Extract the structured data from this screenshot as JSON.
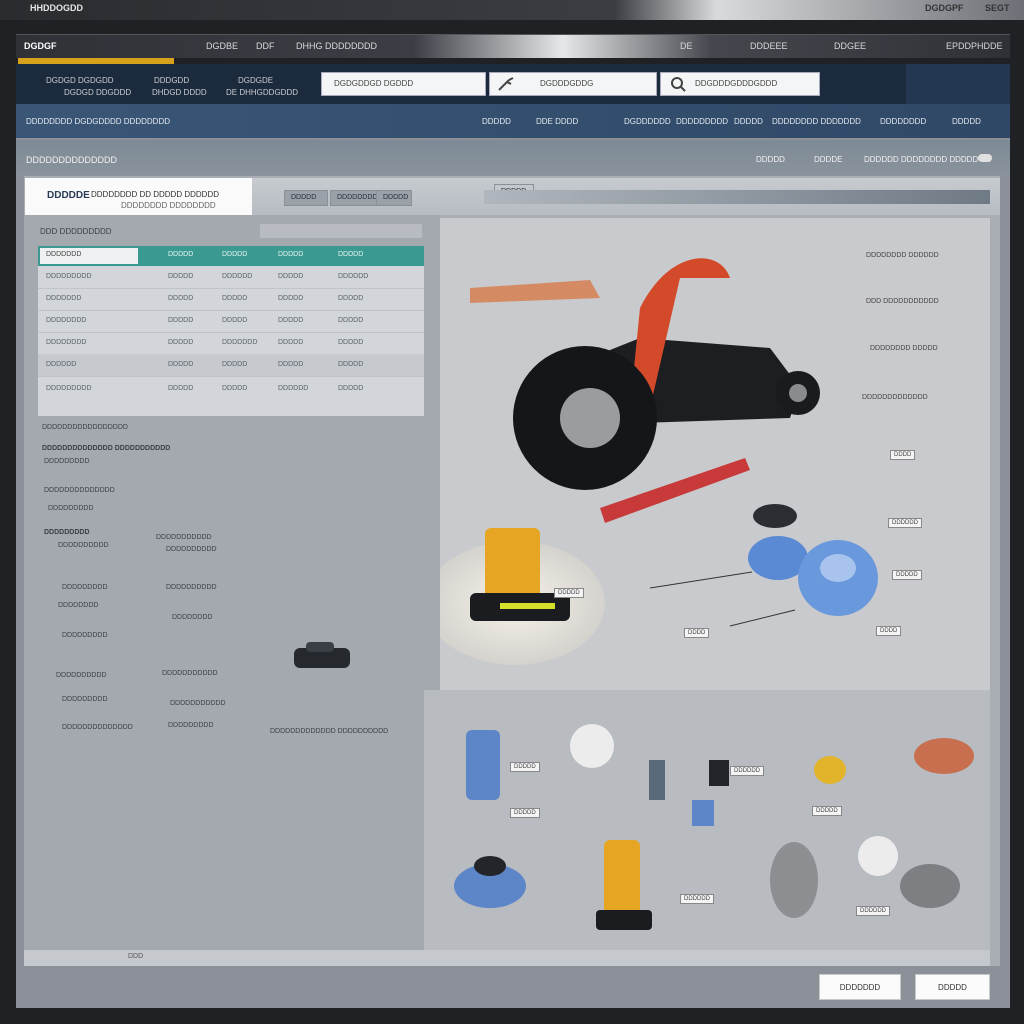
{
  "window": {
    "title": "HHDDOGDD",
    "right_items": [
      "DGDGPF",
      "SEGT"
    ]
  },
  "menubar": {
    "brand": "DGDGF",
    "items": [
      "DGDBE",
      "DDF",
      "DHHG DDDDDDDD"
    ],
    "right_items": [
      "DE",
      "DDDEEE",
      "DDGEE",
      "EPDDPHDDE"
    ]
  },
  "toolbar": {
    "group1": [
      "DGDGD DGDGDD",
      "DGDGD DDGDDD"
    ],
    "group2": [
      "DDDGDD",
      "DHDGD DDDD"
    ],
    "group3": [
      "DGDGDE",
      "DE DHHGDDGDDD"
    ],
    "search1": "DGDGDDGD DGDDD",
    "search2": "DGDDDGDDG",
    "search3": "DDGDDDGDDDGDDD"
  },
  "navband": {
    "left": "DDDDDDDD DGDGDDDD DDDDDDDD",
    "items": [
      "DDDDD",
      "DDE DDDD",
      "DGDDDDDD",
      "DDDDDDDDD",
      "DDDDD",
      "DDDDDDDD DDDDDDD",
      "DDDDDDDD",
      "DDDDD"
    ]
  },
  "breadcrumb": {
    "left": "DDDDDDDDDDDDDD",
    "right": [
      "DDDDD",
      "DDDDE",
      "DDDDDD DDDDDDDD DDDDD"
    ]
  },
  "logo": {
    "name": "DDDDDE",
    "line1": "DDDDDDDD DD DDDDD DDDDDD",
    "line2": "DDDDDDDD DDDDDDDD"
  },
  "tabs": [
    "DDDDD",
    "DDDDDDDD",
    "DDDDD",
    "DDDDD"
  ],
  "leftpanel": {
    "heading": "DDD DDDDDDDDD",
    "table_headers": [
      "DDDDDDD",
      "DDDDD",
      "DDDDD",
      "DDDDD",
      "DDDDD"
    ],
    "rows": [
      [
        "DDDDDDDDD",
        "DDDDD",
        "DDDDDD",
        "DDDDD",
        "DDDDDD"
      ],
      [
        "DDDDDDD",
        "DDDDD",
        "DDDDD",
        "DDDDD",
        "DDDDD"
      ],
      [
        "DDDDDDDD",
        "DDDDD",
        "DDDDD",
        "DDDDD",
        "DDDDD"
      ],
      [
        "DDDDDDDD",
        "DDDDD",
        "DDDDDDD",
        "DDDDD",
        "DDDDD"
      ],
      [
        "DDDDDD",
        "DDDDD",
        "DDDDD",
        "DDDDD",
        "DDDDD"
      ],
      [
        "DDDDDDDDD",
        "DDDDD",
        "DDDDD",
        "DDDDDD",
        "DDDDD"
      ]
    ],
    "section1_title": "DDDDDDDDDDDDDDDDD",
    "section1_line": "DDDDDDDDDDDDDD DDDDDDDDDDD",
    "section1_sub": "DDDDDDDDD",
    "section2_line1": "DDDDDDDDDDDDDD",
    "section2_line2": "DDDDDDDDD",
    "section3_title": "DDDDDDDDD",
    "list_left": [
      "DDDDDDDDDD",
      "DDDDDDDDD",
      "DDDDDDDD",
      "DDDDDDDDD",
      "DDDDDDDDDD",
      "DDDDDDDDD",
      "DDDDDDDDDDDDDD"
    ],
    "list_right": [
      "DDDDDDDDDDD",
      "DDDDDDDDDD",
      "DDDDDDDDDD",
      "DDDDDDDD",
      "DDDDDDDDDDD",
      "DDDDDDDDDDD",
      "DDDDDDDDD"
    ],
    "caption": "DDDDDDDDDDDDD DDDDDDDDDD"
  },
  "viewer": {
    "labels_right": [
      "DDDDDDDD DDDDDD",
      "DDD DDDDDDDDDDD",
      "DDDDDDDD DDDDD",
      "DDDDDDDDDDDDD"
    ],
    "callouts": [
      "DDDD",
      "DDDDDD",
      "DDDDD",
      "DDDD",
      "DDDD",
      "DDDDD"
    ]
  },
  "gallery": {
    "callouts": [
      "DDDDD",
      "DDDDD",
      "DDDDDD",
      "DDDDD",
      "DDDDDD",
      "DDDDDD"
    ]
  },
  "bottom_strip": {
    "text": "DDD"
  },
  "buttons": {
    "primary": "DDDDDDD",
    "secondary": "DDDDD"
  }
}
